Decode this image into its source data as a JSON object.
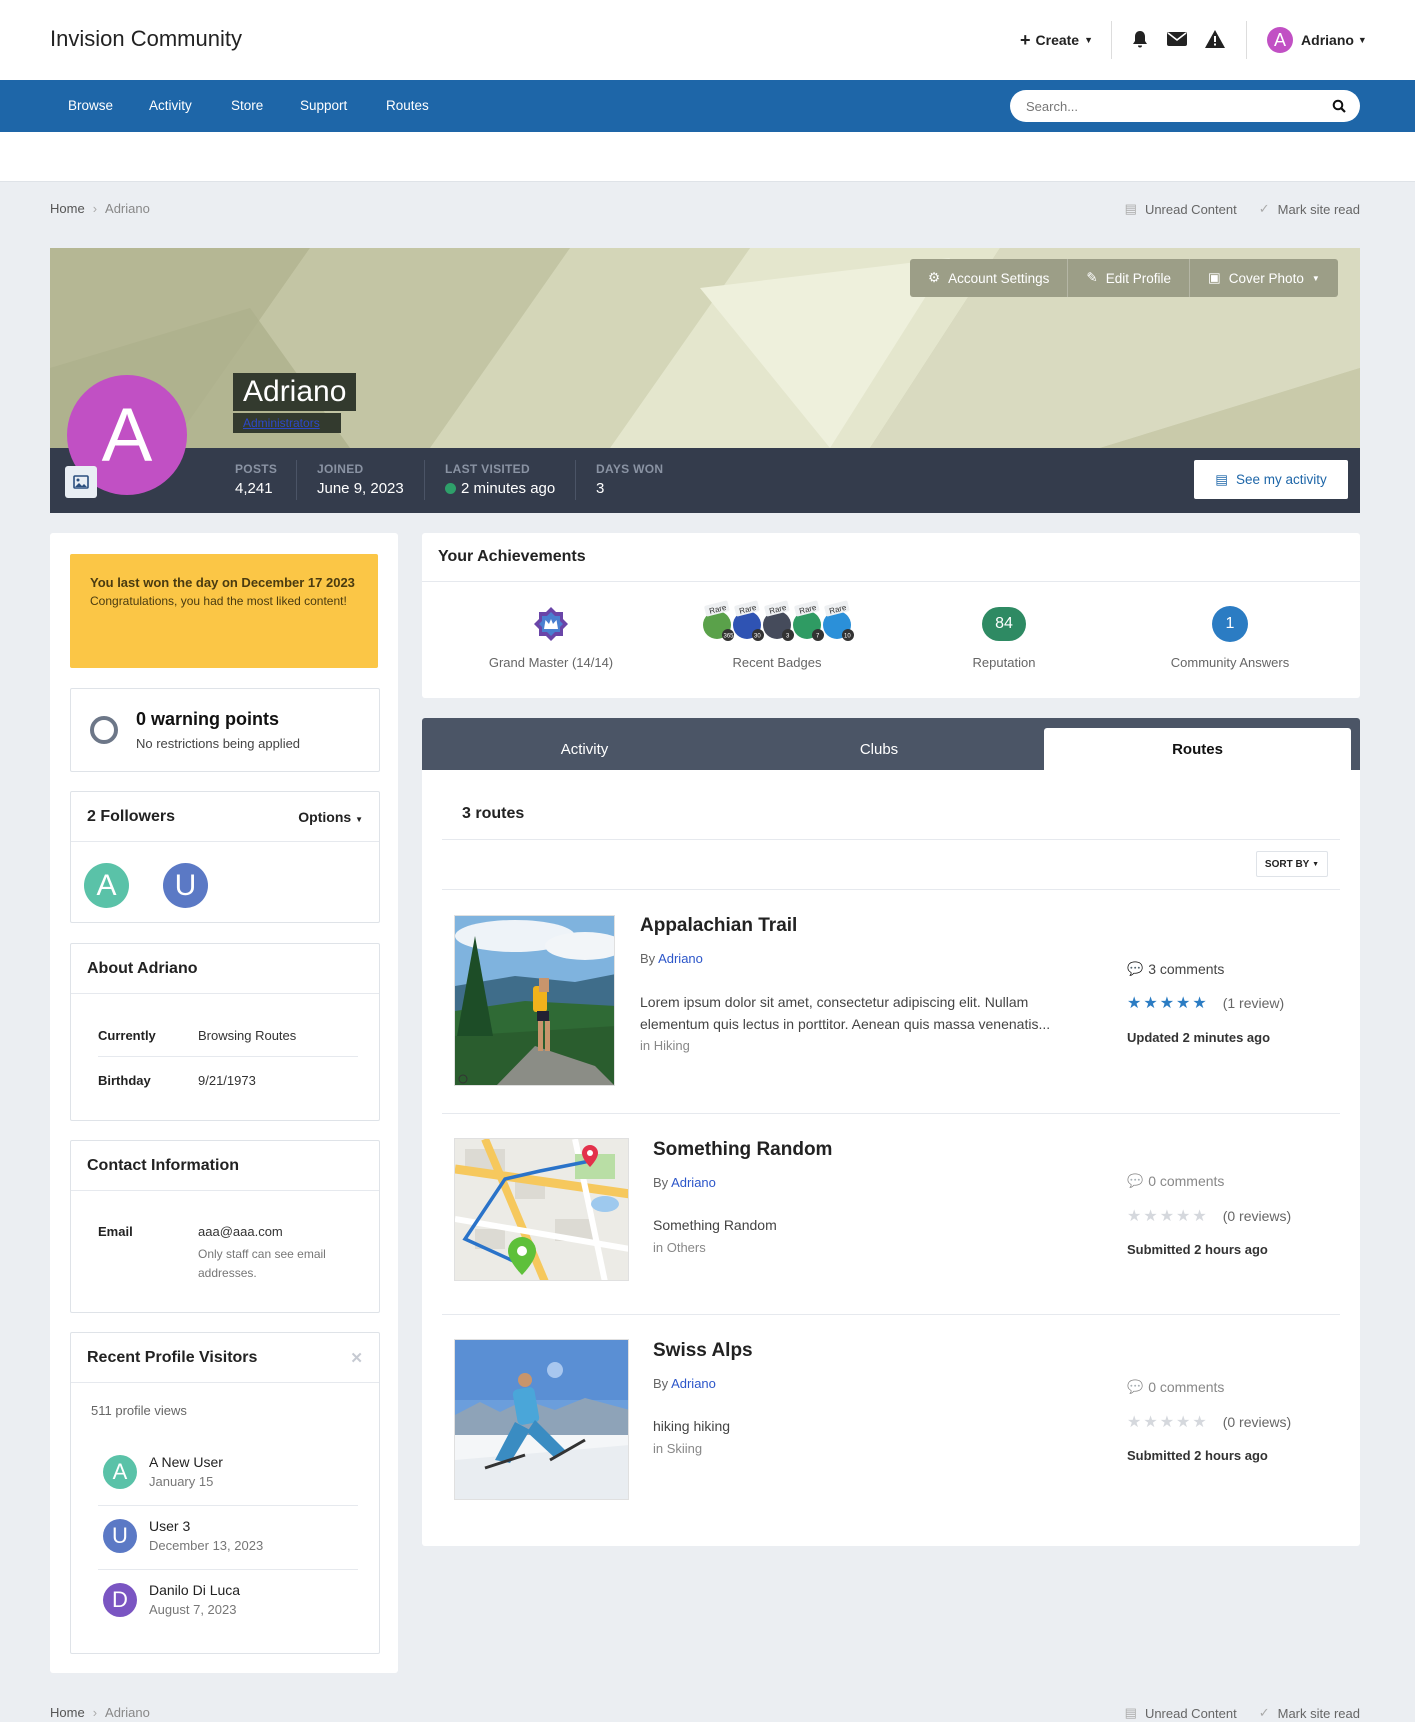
{
  "header": {
    "site_title": "Invision Community",
    "create_label": "Create",
    "user_name": "Adriano",
    "user_initial": "A",
    "icons": [
      "bell-icon",
      "envelope-icon",
      "warning-icon"
    ]
  },
  "nav": {
    "items": [
      "Browse",
      "Activity",
      "Store",
      "Support",
      "Routes"
    ],
    "search_placeholder": "Search..."
  },
  "breadcrumb": {
    "home": "Home",
    "current": "Adriano",
    "unread": "Unread Content",
    "mark_read": "Mark site read"
  },
  "profile": {
    "name": "Adriano",
    "initial": "A",
    "role": "Administrators",
    "buttons": {
      "account_settings": "Account Settings",
      "edit_profile": "Edit Profile",
      "cover_photo": "Cover Photo"
    },
    "stats": [
      {
        "label": "POSTS",
        "value": "4,241"
      },
      {
        "label": "JOINED",
        "value": "June 9, 2023"
      },
      {
        "label": "LAST VISITED",
        "value": "2 minutes ago"
      },
      {
        "label": "DAYS WON",
        "value": "3"
      }
    ],
    "see_activity": "See my activity",
    "colors": {
      "avatar": "#c150c4",
      "online": "#2ea06a"
    }
  },
  "sidebar": {
    "day_won": {
      "title": "You last won the day on December 17 2023",
      "text": "Congratulations, you had the most liked content!"
    },
    "warning": {
      "title": "0 warning points",
      "text": "No restrictions being applied"
    },
    "followers": {
      "title": "2 Followers",
      "options": "Options",
      "avatars": [
        {
          "initial": "A",
          "color": "#5ac2a8"
        },
        {
          "initial": "U",
          "color": "#5b79c5"
        }
      ]
    },
    "about": {
      "title": "About Adriano",
      "rows": [
        {
          "label": "Currently",
          "value": "Browsing Routes"
        },
        {
          "label": "Birthday",
          "value": "9/21/1973"
        }
      ]
    },
    "contact": {
      "title": "Contact Information",
      "email_label": "Email",
      "email": "aaa@aaa.com",
      "note": "Only staff can see email addresses."
    },
    "visitors": {
      "title": "Recent Profile Visitors",
      "views": "511 profile views",
      "items": [
        {
          "initial": "A",
          "name": "A New User",
          "date": "January 15",
          "color": "#5ac2a8"
        },
        {
          "initial": "U",
          "name": "User 3",
          "date": "December 13, 2023",
          "color": "#5b79c5"
        },
        {
          "initial": "D",
          "name": "Danilo Di Luca",
          "date": "August 7, 2023",
          "color": "#7a55c2"
        }
      ]
    }
  },
  "achievements": {
    "title": "Your Achievements",
    "items": [
      {
        "label": "Grand Master (14/14)",
        "icon": "crown-icon"
      },
      {
        "label": "Recent Badges",
        "icon": "badges-icon"
      },
      {
        "label": "Reputation",
        "value": "84",
        "color": "#2e8a63"
      },
      {
        "label": "Community Answers",
        "value": "1",
        "color": "#2b7cc3"
      }
    ],
    "badges": [
      {
        "tag": "Rare",
        "count": "365",
        "color": "#5aa14a"
      },
      {
        "tag": "Rare",
        "count": "30",
        "color": "#2f53b3"
      },
      {
        "tag": "Rare",
        "count": "3",
        "color": "#454b5b"
      },
      {
        "tag": "Rare",
        "count": "7",
        "color": "#2f9b63"
      },
      {
        "tag": "Rare",
        "count": "10",
        "color": "#2b90d9"
      }
    ]
  },
  "tabs": {
    "items": [
      "Activity",
      "Clubs",
      "Routes"
    ],
    "active": "Routes"
  },
  "routes": {
    "count": "3 routes",
    "sort_by": "SORT BY",
    "by_prefix": "By",
    "items": [
      {
        "title": "Appalachian Trail",
        "author": "Adriano",
        "desc": "Lorem ipsum dolor sit amet, consectetur adipiscing elit. Nullam elementum quis lectus in porttitor. Aenean quis massa venenatis...",
        "category": "in Hiking",
        "comments": "3 comments",
        "reviews": "(1 review)",
        "rating": 5,
        "updated": "Updated 2 minutes ago"
      },
      {
        "title": "Something Random",
        "author": "Adriano",
        "desc": "Something Random",
        "category": "in Others",
        "comments": "0 comments",
        "reviews": "(0 reviews)",
        "rating": 0,
        "updated": "Submitted 2 hours ago"
      },
      {
        "title": "Swiss Alps",
        "author": "Adriano",
        "desc": "hiking hiking",
        "category": "in Skiing",
        "comments": "0 comments",
        "reviews": "(0 reviews)",
        "rating": 0,
        "updated": "Submitted 2 hours ago"
      }
    ]
  }
}
